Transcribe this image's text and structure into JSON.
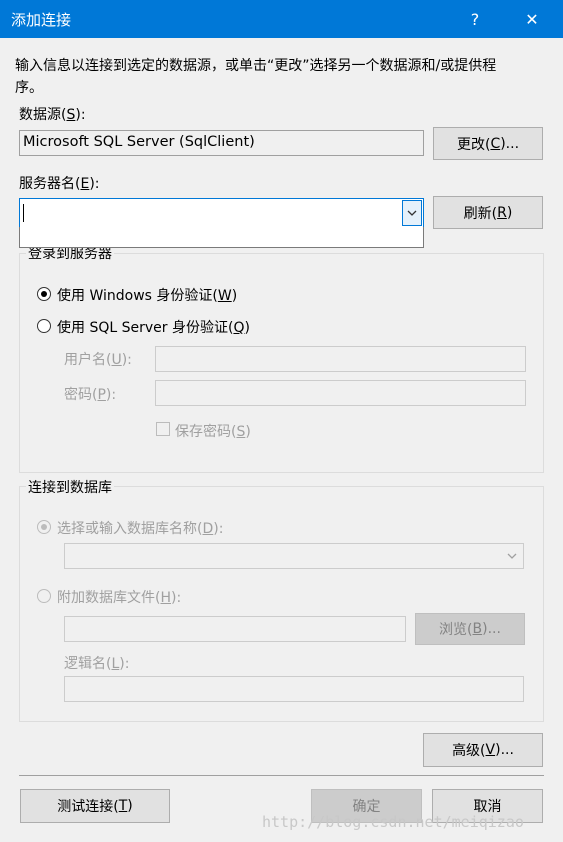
{
  "window": {
    "title": "添加连接",
    "help_glyph": "?",
    "close_glyph": "✕",
    "accent": "#0078d7"
  },
  "intro": {
    "line1": "输入信息以连接到选定的数据源，或单击“更改”选择另一个数据源和/或提供程",
    "line2": "序。"
  },
  "datasource": {
    "label": "数据源(",
    "accel": "S",
    "label_end": "):",
    "value": "Microsoft SQL Server (SqlClient)",
    "change_button": "更改(",
    "change_accel": "C",
    "change_end": ")..."
  },
  "server": {
    "label": "服务器名(",
    "accel": "E",
    "label_end": "):",
    "value": "",
    "dropdown_icon": "chevron-down-icon",
    "refresh_button": "刷新(",
    "refresh_accel": "R",
    "refresh_end": ")"
  },
  "login_group": {
    "legend": "登录到服务器",
    "windows_auth": {
      "text": "使用 Windows 身份验证(",
      "accel": "W",
      "end": ")",
      "checked": true
    },
    "sql_auth": {
      "text": "使用 SQL Server 身份验证(",
      "accel": "Q",
      "end": ")",
      "checked": false
    },
    "username": {
      "label": "用户名(",
      "accel": "U",
      "end": "):",
      "value": ""
    },
    "password": {
      "label": "密码(",
      "accel": "P",
      "end": "):",
      "value": ""
    },
    "save_password": {
      "text": "保存密码(",
      "accel": "S",
      "end": ")",
      "checked": false
    }
  },
  "db_group": {
    "legend": "连接到数据库",
    "select_db": {
      "text": "选择或输入数据库名称(",
      "accel": "D",
      "end": "):",
      "checked": true
    },
    "attach_file": {
      "text": "附加数据库文件(",
      "accel": "H",
      "end": "):",
      "checked": false
    },
    "browse_button": {
      "text": "浏览(",
      "accel": "B",
      "end": ")..."
    },
    "logical_name": {
      "label": "逻辑名(",
      "accel": "L",
      "end": "):",
      "value": ""
    }
  },
  "footer": {
    "advanced_button": {
      "text": "高级(",
      "accel": "V",
      "end": ")..."
    },
    "test_button": {
      "text": "测试连接(",
      "accel": "T",
      "end": ")"
    },
    "ok_button": "确定",
    "cancel_button": "取消"
  },
  "watermark": "http://blog.csdn.net/meiqizao"
}
